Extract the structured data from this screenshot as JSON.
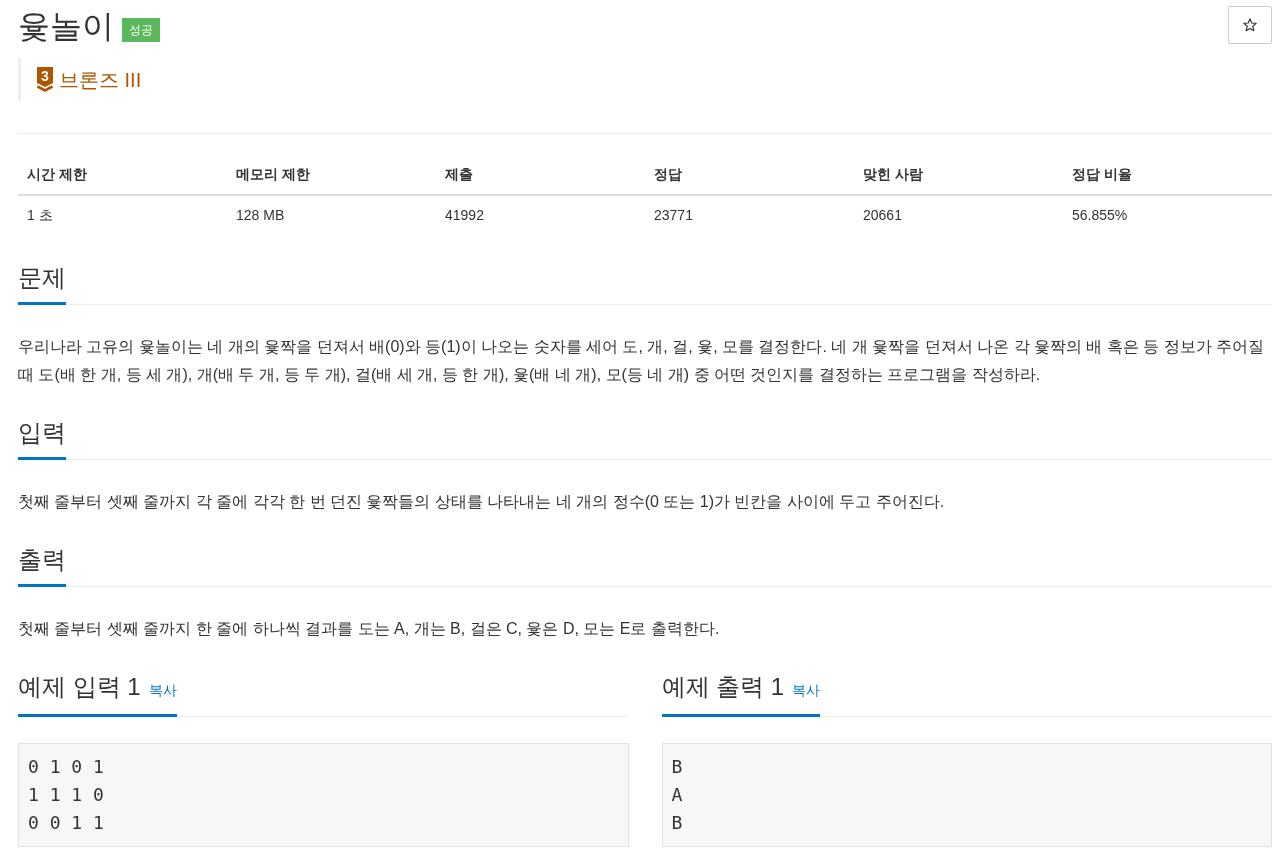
{
  "problem": {
    "title": "윷놀이",
    "result_badge": "성공",
    "starred": false
  },
  "tier": {
    "number": "3",
    "label": "브론즈 III"
  },
  "info_table": {
    "columns": [
      "시간 제한",
      "메모리 제한",
      "제출",
      "정답",
      "맞힌 사람",
      "정답 비율"
    ],
    "rows": [
      [
        "1 초",
        "128 MB",
        "41992",
        "23771",
        "20661",
        "56.855%"
      ]
    ]
  },
  "sections": [
    {
      "heading": "문제",
      "text": "우리나라 고유의 윷놀이는 네 개의 윷짝을 던져서 배(0)와 등(1)이 나오는 숫자를 세어 도, 개, 걸, 윷, 모를 결정한다. 네 개 윷짝을 던져서 나온 각 윷짝의 배 혹은 등 정보가 주어질 때 도(배 한 개, 등 세 개), 개(배 두 개, 등 두 개), 걸(배 세 개, 등 한 개), 윷(배 네 개), 모(등 네 개) 중 어떤 것인지를 결정하는 프로그램을 작성하라."
    },
    {
      "heading": "입력",
      "text": "첫째 줄부터 셋째 줄까지 각 줄에 각각 한 번 던진 윷짝들의 상태를 나타내는 네 개의 정수(0 또는 1)가 빈칸을 사이에 두고 주어진다."
    },
    {
      "heading": "출력",
      "text": "첫째 줄부터 셋째 줄까지 한 줄에 하나씩 결과를 도는 A, 개는 B, 걸은 C, 윷은 D, 모는 E로 출력한다."
    }
  ],
  "samples": [
    {
      "heading": "예제 입력 1",
      "copy_label": "복사",
      "lines": [
        "0 1 0 1",
        "1 1 1 0",
        "0 0 1 1"
      ]
    },
    {
      "heading": "예제 출력 1",
      "copy_label": "복사",
      "lines": [
        "B",
        "A",
        "B"
      ]
    }
  ]
}
